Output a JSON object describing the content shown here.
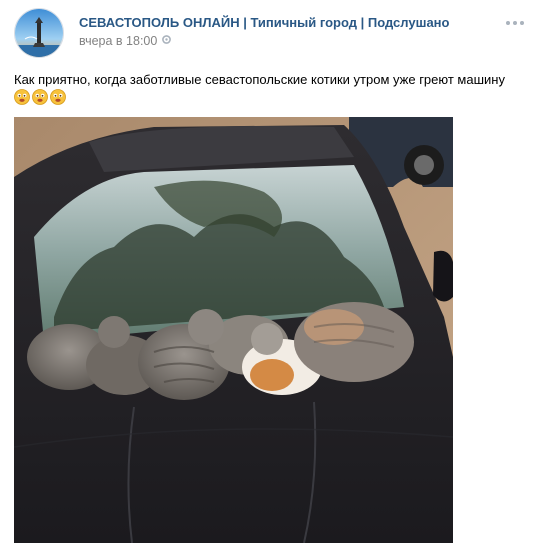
{
  "post": {
    "group_name": "СЕВАСТОПОЛЬ ОНЛАЙН | Типичный город | Подслушано",
    "time": "вчера в 18:00",
    "text": "Как приятно, когда заботливые севастопольские котики утром уже греют машину",
    "emojis": [
      "smiling-face-emoji",
      "smiling-face-emoji",
      "smiling-face-emoji"
    ]
  },
  "icons": {
    "time_icon": "gear-icon",
    "more_icon": "more-dots-icon"
  },
  "colors": {
    "link": "#2a5885",
    "meta": "#828282",
    "emoji": "#f7c23c"
  }
}
